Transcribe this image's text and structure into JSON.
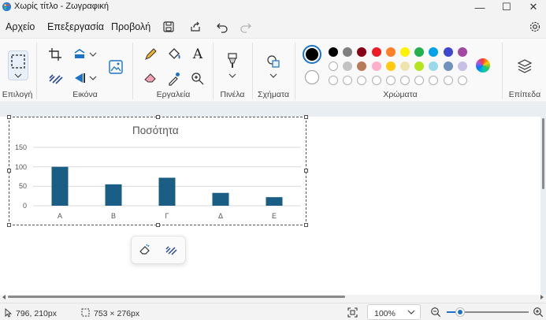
{
  "window": {
    "title": "Χωρίς τίτλο - Ζωγραφική",
    "minimize": "—",
    "maximize": "☐",
    "close": "✕"
  },
  "menu": {
    "file": "Αρχείο",
    "edit": "Επεξεργασία",
    "view": "Προβολή"
  },
  "ribbon": {
    "groups": {
      "selection": "Επιλογή",
      "image": "Εικόνα",
      "tools": "Εργαλεία",
      "brushes": "Πινέλα",
      "shapes": "Σχήματα",
      "colors": "Χρώματα",
      "layers": "Επίπεδα"
    },
    "text_tool": "A",
    "palette_row1": [
      "#000000",
      "#7f7f7f",
      "#880015",
      "#ed1c24",
      "#ff7f27",
      "#fff200",
      "#22b14c",
      "#00a2e8",
      "#3f48cc",
      "#a349a4"
    ],
    "palette_row2": [
      "#ffffff",
      "#c3c3c3",
      "#b97a57",
      "#ffaec9",
      "#ffc90e",
      "#efe4b0",
      "#b5e61d",
      "#99d9ea",
      "#7092be",
      "#c8bfe7"
    ],
    "primary_color": "#000000",
    "secondary_color": "#ffffff"
  },
  "chart_data": {
    "type": "bar",
    "title": "Ποσότητα",
    "categories": [
      "Α",
      "Β",
      "Γ",
      "Δ",
      "Ε"
    ],
    "values": [
      100,
      55,
      72,
      33,
      22
    ],
    "yticks": [
      "150",
      "100",
      "50",
      "0"
    ],
    "ylim": [
      0,
      150
    ],
    "bar_color": "#1a5e86",
    "grid": true,
    "xlabel": "",
    "ylabel": ""
  },
  "status": {
    "cursor_position": "796, 210px",
    "selection_size": "753 × 276px",
    "zoom": "100%"
  }
}
